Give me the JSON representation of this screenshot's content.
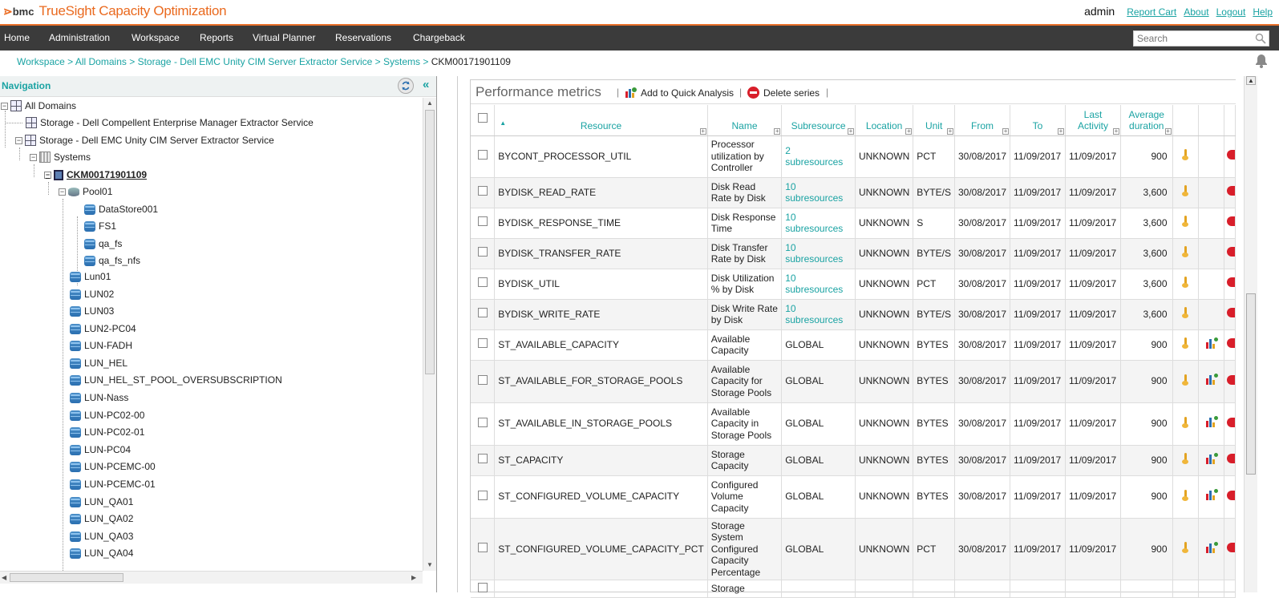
{
  "header": {
    "brand_logo": "⋗",
    "brand_company": "bmc",
    "brand_product": "TrueSight Capacity Optimization",
    "user": "admin",
    "links": [
      "Report Cart",
      "About",
      "Logout",
      "Help"
    ]
  },
  "menu": {
    "items": [
      "Home",
      "Administration",
      "Workspace",
      "Reports",
      "Virtual Planner",
      "Reservations",
      "Chargeback"
    ],
    "search_placeholder": "Search"
  },
  "breadcrumb": {
    "items": [
      "Workspace",
      "All Domains",
      "Storage - Dell EMC Unity CIM Server Extractor Service",
      "Systems"
    ],
    "separator": ">",
    "current": "CKM00171901109"
  },
  "navigation": {
    "title": "Navigation",
    "collapse_glyph": "«",
    "tree": [
      "All Domains",
      "Storage - Dell Compellent Enterprise Manager Extractor Service",
      "Storage - Dell EMC Unity CIM Server Extractor Service",
      "Systems",
      "CKM00171901109",
      "Pool01",
      "DataStore001",
      "FS1",
      "qa_fs",
      "qa_fs_nfs",
      "Lun01",
      "LUN02",
      "LUN03",
      "LUN2-PC04",
      "LUN-FADH",
      "LUN_HEL",
      "LUN_HEL_ST_POOL_OVERSUBSCRIPTION",
      "LUN-Nass",
      "LUN-PC02-00",
      "LUN-PC02-01",
      "LUN-PC04",
      "LUN-PCEMC-00",
      "LUN-PCEMC-01",
      "LUN_QA01",
      "LUN_QA02",
      "LUN_QA03",
      "LUN_QA04"
    ]
  },
  "metrics": {
    "title": "Performance metrics",
    "sep": "|",
    "add_quick_analysis": "Add to Quick Analysis",
    "delete_series": "Delete series",
    "columns": {
      "resource": "Resource",
      "name": "Name",
      "subresource": "Subresource",
      "location": "Location",
      "unit": "Unit",
      "from": "From",
      "to": "To",
      "last_activity_1": "Last",
      "last_activity_2": "Activity",
      "avg_duration_1": "Average",
      "avg_duration_2": "duration"
    },
    "rows": [
      {
        "resource": "BYCONT_PROCESSOR_UTIL",
        "name": "Processor utilization by Controller",
        "sub1": "2",
        "sub2": "subresources",
        "location": "UNKNOWN",
        "unit": "PCT",
        "from": "30/08/2017",
        "to": "11/09/2017",
        "last": "11/09/2017",
        "avg": "900",
        "chart": false
      },
      {
        "resource": "BYDISK_READ_RATE",
        "name": "Disk Read Rate by Disk",
        "sub1": "10",
        "sub2": "subresources",
        "location": "UNKNOWN",
        "unit": "BYTE/S",
        "from": "30/08/2017",
        "to": "11/09/2017",
        "last": "11/09/2017",
        "avg": "3,600",
        "chart": false
      },
      {
        "resource": "BYDISK_RESPONSE_TIME",
        "name": "Disk Response Time",
        "sub1": "10",
        "sub2": "subresources",
        "location": "UNKNOWN",
        "unit": "S",
        "from": "30/08/2017",
        "to": "11/09/2017",
        "last": "11/09/2017",
        "avg": "3,600",
        "chart": false
      },
      {
        "resource": "BYDISK_TRANSFER_RATE",
        "name": "Disk Transfer Rate by Disk",
        "sub1": "10",
        "sub2": "subresources",
        "location": "UNKNOWN",
        "unit": "BYTE/S",
        "from": "30/08/2017",
        "to": "11/09/2017",
        "last": "11/09/2017",
        "avg": "3,600",
        "chart": false
      },
      {
        "resource": "BYDISK_UTIL",
        "name": "Disk Utilization % by Disk",
        "sub1": "10",
        "sub2": "subresources",
        "location": "UNKNOWN",
        "unit": "PCT",
        "from": "30/08/2017",
        "to": "11/09/2017",
        "last": "11/09/2017",
        "avg": "3,600",
        "chart": false
      },
      {
        "resource": "BYDISK_WRITE_RATE",
        "name": "Disk Write Rate by Disk",
        "sub1": "10",
        "sub2": "subresources",
        "location": "UNKNOWN",
        "unit": "BYTE/S",
        "from": "30/08/2017",
        "to": "11/09/2017",
        "last": "11/09/2017",
        "avg": "3,600",
        "chart": false
      },
      {
        "resource": "ST_AVAILABLE_CAPACITY",
        "name": "Available Capacity",
        "sub1": "GLOBAL",
        "sub2": "",
        "location": "UNKNOWN",
        "unit": "BYTES",
        "from": "30/08/2017",
        "to": "11/09/2017",
        "last": "11/09/2017",
        "avg": "900",
        "chart": true
      },
      {
        "resource": "ST_AVAILABLE_FOR_STORAGE_POOLS",
        "name": "Available Capacity for Storage Pools",
        "sub1": "GLOBAL",
        "sub2": "",
        "location": "UNKNOWN",
        "unit": "BYTES",
        "from": "30/08/2017",
        "to": "11/09/2017",
        "last": "11/09/2017",
        "avg": "900",
        "chart": true
      },
      {
        "resource": "ST_AVAILABLE_IN_STORAGE_POOLS",
        "name": "Available Capacity in Storage Pools",
        "sub1": "GLOBAL",
        "sub2": "",
        "location": "UNKNOWN",
        "unit": "BYTES",
        "from": "30/08/2017",
        "to": "11/09/2017",
        "last": "11/09/2017",
        "avg": "900",
        "chart": true
      },
      {
        "resource": "ST_CAPACITY",
        "name": "Storage Capacity",
        "sub1": "GLOBAL",
        "sub2": "",
        "location": "UNKNOWN",
        "unit": "BYTES",
        "from": "30/08/2017",
        "to": "11/09/2017",
        "last": "11/09/2017",
        "avg": "900",
        "chart": true
      },
      {
        "resource": "ST_CONFIGURED_VOLUME_CAPACITY",
        "name": "Configured Volume Capacity",
        "sub1": "GLOBAL",
        "sub2": "",
        "location": "UNKNOWN",
        "unit": "BYTES",
        "from": "30/08/2017",
        "to": "11/09/2017",
        "last": "11/09/2017",
        "avg": "900",
        "chart": true
      },
      {
        "resource": "ST_CONFIGURED_VOLUME_CAPACITY_PCT",
        "name": "Storage System Configured Capacity Percentage",
        "sub1": "GLOBAL",
        "sub2": "",
        "location": "UNKNOWN",
        "unit": "PCT",
        "from": "30/08/2017",
        "to": "11/09/2017",
        "last": "11/09/2017",
        "avg": "900",
        "chart": true
      },
      {
        "resource": "",
        "name": "Storage",
        "sub1": "",
        "sub2": "",
        "location": "",
        "unit": "",
        "from": "",
        "to": "",
        "last": "",
        "avg": "",
        "chart": false
      }
    ]
  },
  "colors": {
    "accent": "#1aa3a3",
    "brand": "#ea6a1f",
    "menubar": "#3b3b3b",
    "delete": "#d81e2a"
  }
}
